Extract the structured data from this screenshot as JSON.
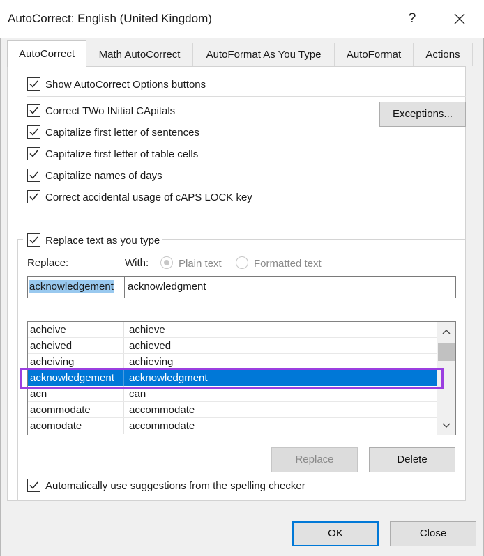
{
  "window": {
    "title": "AutoCorrect: English (United Kingdom)",
    "help_label": "?",
    "close_icon": "close-icon"
  },
  "tabs": [
    {
      "label": "AutoCorrect",
      "active": true
    },
    {
      "label": "Math AutoCorrect",
      "active": false
    },
    {
      "label": "AutoFormat As You Type",
      "active": false
    },
    {
      "label": "AutoFormat",
      "active": false
    },
    {
      "label": "Actions",
      "active": false
    }
  ],
  "options": {
    "show_buttons": {
      "label": "Show AutoCorrect Options buttons",
      "checked": true
    },
    "correct_two_initial": {
      "label": "Correct TWo INitial CApitals",
      "checked": true
    },
    "capitalize_sentences": {
      "label": "Capitalize first letter of sentences",
      "checked": true
    },
    "capitalize_table_cells": {
      "label": "Capitalize first letter of table cells",
      "checked": true
    },
    "capitalize_days": {
      "label": "Capitalize names of days",
      "checked": true
    },
    "caps_lock": {
      "label": "Correct accidental usage of cAPS LOCK key",
      "checked": true
    },
    "exceptions_label": "Exceptions..."
  },
  "replace_group": {
    "replace_as_you_type": {
      "label": "Replace text as you type",
      "checked": true
    },
    "replace_label": "Replace:",
    "with_label": "With:",
    "plain_text_label": "Plain text",
    "formatted_text_label": "Formatted text",
    "selected_format": "plain",
    "replace_value": "acknowledgement",
    "with_value": "acknowledgment",
    "entries": [
      {
        "replace": "acheive",
        "with": "achieve",
        "selected": false
      },
      {
        "replace": "acheived",
        "with": "achieved",
        "selected": false
      },
      {
        "replace": "acheiving",
        "with": "achieving",
        "selected": false
      },
      {
        "replace": "acknowledgement",
        "with": "acknowledgment",
        "selected": true
      },
      {
        "replace": "acn",
        "with": "can",
        "selected": false
      },
      {
        "replace": "acommodate",
        "with": "accommodate",
        "selected": false
      },
      {
        "replace": "acomodate",
        "with": "accommodate",
        "selected": false
      }
    ],
    "replace_button": "Replace",
    "delete_button": "Delete",
    "use_suggestions": {
      "label": "Automatically use suggestions from the spelling checker",
      "checked": true
    }
  },
  "footer": {
    "ok_label": "OK",
    "close_label": "Close"
  },
  "colors": {
    "selection": "#0078d7",
    "annotation_highlight": "#9b3fe0"
  }
}
